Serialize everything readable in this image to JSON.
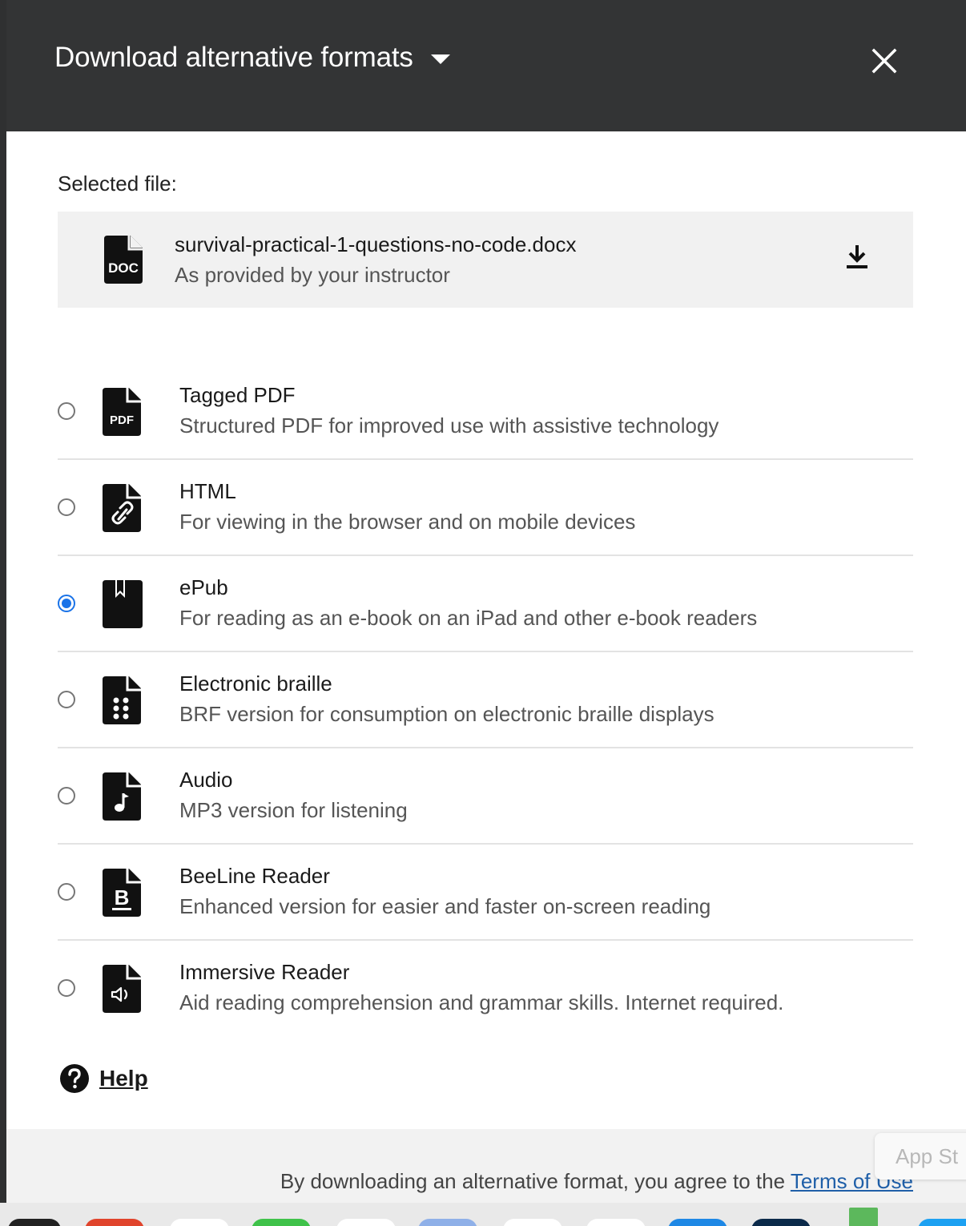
{
  "header": {
    "title": "Download alternative formats"
  },
  "selected_file": {
    "label": "Selected file:",
    "name": "survival-practical-1-questions-no-code.docx",
    "source": "As provided by your instructor",
    "icon": "doc-file-icon",
    "icon_text": "DOC"
  },
  "formats": [
    {
      "title": "Tagged PDF",
      "description": "Structured PDF for improved use with assistive technology",
      "icon": "pdf-file-icon",
      "icon_text": "PDF",
      "selected": false
    },
    {
      "title": "HTML",
      "description": "For viewing in the browser and on mobile devices",
      "icon": "link-file-icon",
      "selected": false
    },
    {
      "title": "ePub",
      "description": "For reading as an e-book on an iPad and other e-book readers",
      "icon": "bookmark-icon",
      "selected": true
    },
    {
      "title": "Electronic braille",
      "description": "BRF version for consumption on electronic braille displays",
      "icon": "braille-file-icon",
      "selected": false
    },
    {
      "title": "Audio",
      "description": "MP3 version for listening",
      "icon": "audio-file-icon",
      "selected": false
    },
    {
      "title": "BeeLine Reader",
      "description": "Enhanced version for easier and faster on-screen reading",
      "icon": "beeline-file-icon",
      "icon_text": "B",
      "selected": false
    },
    {
      "title": "Immersive Reader",
      "description": "Aid reading comprehension and grammar skills. Internet required.",
      "icon": "speaker-file-icon",
      "selected": false
    }
  ],
  "help": {
    "label": "Help"
  },
  "footer": {
    "agreement_text": "By downloading an alternative format, you agree to the ",
    "terms_link": "Terms of Use"
  },
  "tooltip": {
    "text": "App St"
  },
  "colors": {
    "header_bg": "#333435",
    "accent": "#1a73e8",
    "link": "#1f5fa8"
  }
}
